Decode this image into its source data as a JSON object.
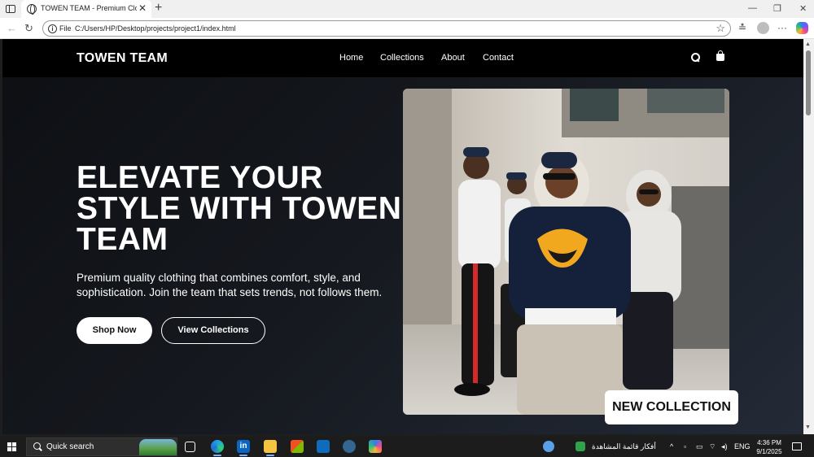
{
  "browser": {
    "tab_title": "TOWEN TEAM - Premium Clothing",
    "scheme_label": "File",
    "url": "C:/Users/HP/Desktop/projects/project1/index.html",
    "win_minimize": "—",
    "win_restore": "❐",
    "win_close": "✕",
    "back_glyph": "←",
    "reload_glyph": "↻",
    "star_glyph": "☆",
    "favorites_glyph": "≛",
    "more_glyph": "···",
    "tab_close_glyph": "✕",
    "new_tab_glyph": "+"
  },
  "site": {
    "brand": "TOWEN TEAM",
    "nav": [
      "Home",
      "Collections",
      "About",
      "Contact"
    ],
    "hero": {
      "title": "ELEVATE YOUR STYLE WITH TOWEN TEAM",
      "subtitle": "Premium quality clothing that combines comfort, style, and sophistication. Join the team that sets trends, not follows them.",
      "primary_button": "Shop Now",
      "secondary_button": "View Collections",
      "badge": "NEW COLLECTION"
    },
    "icons": [
      "search-icon",
      "shopping-bag-icon"
    ]
  },
  "scrollbar": {
    "up": "▲",
    "down": "▼"
  },
  "taskbar": {
    "search_text": "Quick search",
    "news_text": "أفكار قائمة المشاهدة",
    "language": "ENG",
    "time": "4:36 PM",
    "date": "9/1/2025",
    "tray_chevron": "^",
    "apps": [
      "task-view-icon",
      "edge-icon",
      "linkedin-icon",
      "file-explorer-icon",
      "microsoft-store-icon",
      "outlook-icon",
      "pgadmin-icon",
      "copilot-icon"
    ]
  },
  "colors": {
    "header_bg": "#000000",
    "hero_bg": "#15181e",
    "button_primary_bg": "#ffffff",
    "taskbar_bg": "#1c1c1c"
  }
}
